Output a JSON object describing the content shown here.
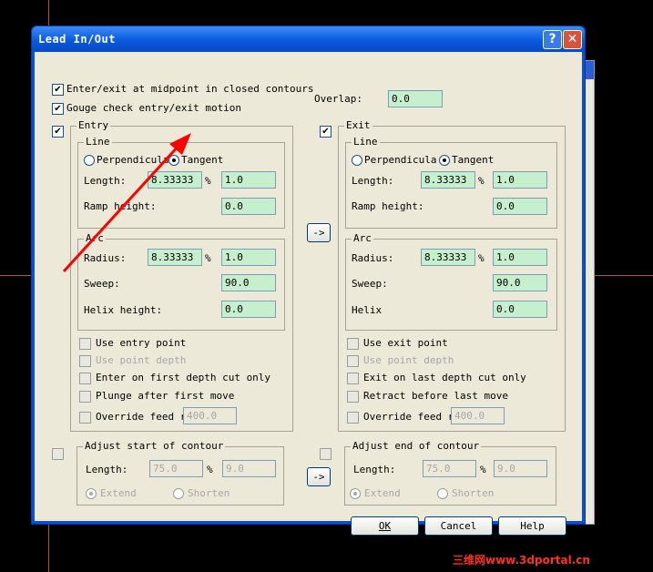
{
  "dialog": {
    "title": "Lead In/Out",
    "help_glyph": "?",
    "close_glyph": "✕",
    "enter_exit_midpoint": "Enter/exit at midpoint in closed contours",
    "gouge_check": "Gouge check entry/exit motion",
    "overlap_label": "Overlap:",
    "overlap_value": "0.0"
  },
  "entry": {
    "title": "Entry",
    "line": {
      "title": "Line",
      "perpendicular": "Perpendicula",
      "tangent": "Tangent",
      "length_label": "Length:",
      "length_value": "8.33333",
      "percent": "%",
      "percent_value": "1.0",
      "ramp_label": "Ramp height:",
      "ramp_value": "0.0"
    },
    "arc": {
      "title": "Arc",
      "radius_label": "Radius:",
      "radius_value": "8.33333",
      "percent": "%",
      "percent_value": "1.0",
      "sweep_label": "Sweep:",
      "sweep_value": "90.0",
      "helix_label": "Helix height:",
      "helix_value": "0.0"
    },
    "options": {
      "use_point": "Use entry point",
      "use_depth": "Use point depth",
      "depth_cut": "Enter on first depth cut only",
      "plunge": "Plunge after first move",
      "override": "Override feed ra",
      "override_value": "400.0"
    }
  },
  "exit": {
    "title": "Exit",
    "line": {
      "title": "Line",
      "perpendicular": "Perpendicula",
      "tangent": "Tangent",
      "length_label": "Length:",
      "length_value": "8.33333",
      "percent": "%",
      "percent_value": "1.0",
      "ramp_label": "Ramp height:",
      "ramp_value": "0.0"
    },
    "arc": {
      "title": "Arc",
      "radius_label": "Radius:",
      "radius_value": "8.33333",
      "percent": "%",
      "percent_value": "1.0",
      "sweep_label": "Sweep:",
      "sweep_value": "90.0",
      "helix_label": "Helix",
      "helix_value": "0.0"
    },
    "options": {
      "use_point": "Use exit point",
      "use_depth": "Use point depth",
      "depth_cut": "Exit on last depth cut only",
      "retract": "Retract before last move",
      "override": "Override feed ra",
      "override_value": "400.0"
    }
  },
  "copy_button": "->",
  "adjust_start": {
    "title": "Adjust start of contour",
    "length_label": "Length:",
    "length_value": "75.0",
    "percent": "%",
    "percent_value": "9.0",
    "extend": "Extend",
    "shorten": "Shorten"
  },
  "adjust_end": {
    "title": "Adjust end of contour",
    "length_label": "Length:",
    "length_value": "75.0",
    "percent": "%",
    "percent_value": "9.0",
    "extend": "Extend",
    "shorten": "Shorten"
  },
  "buttons": {
    "ok": "OK",
    "cancel": "Cancel",
    "help": "Help"
  },
  "check_mark": "✔",
  "watermark": "三维网www.3dportal.cn",
  "colors": {
    "titlebar": "#0a5ae0",
    "field": "#c6efce",
    "dialog_bg": "#ece9d8",
    "arrow": "#ff0000"
  }
}
